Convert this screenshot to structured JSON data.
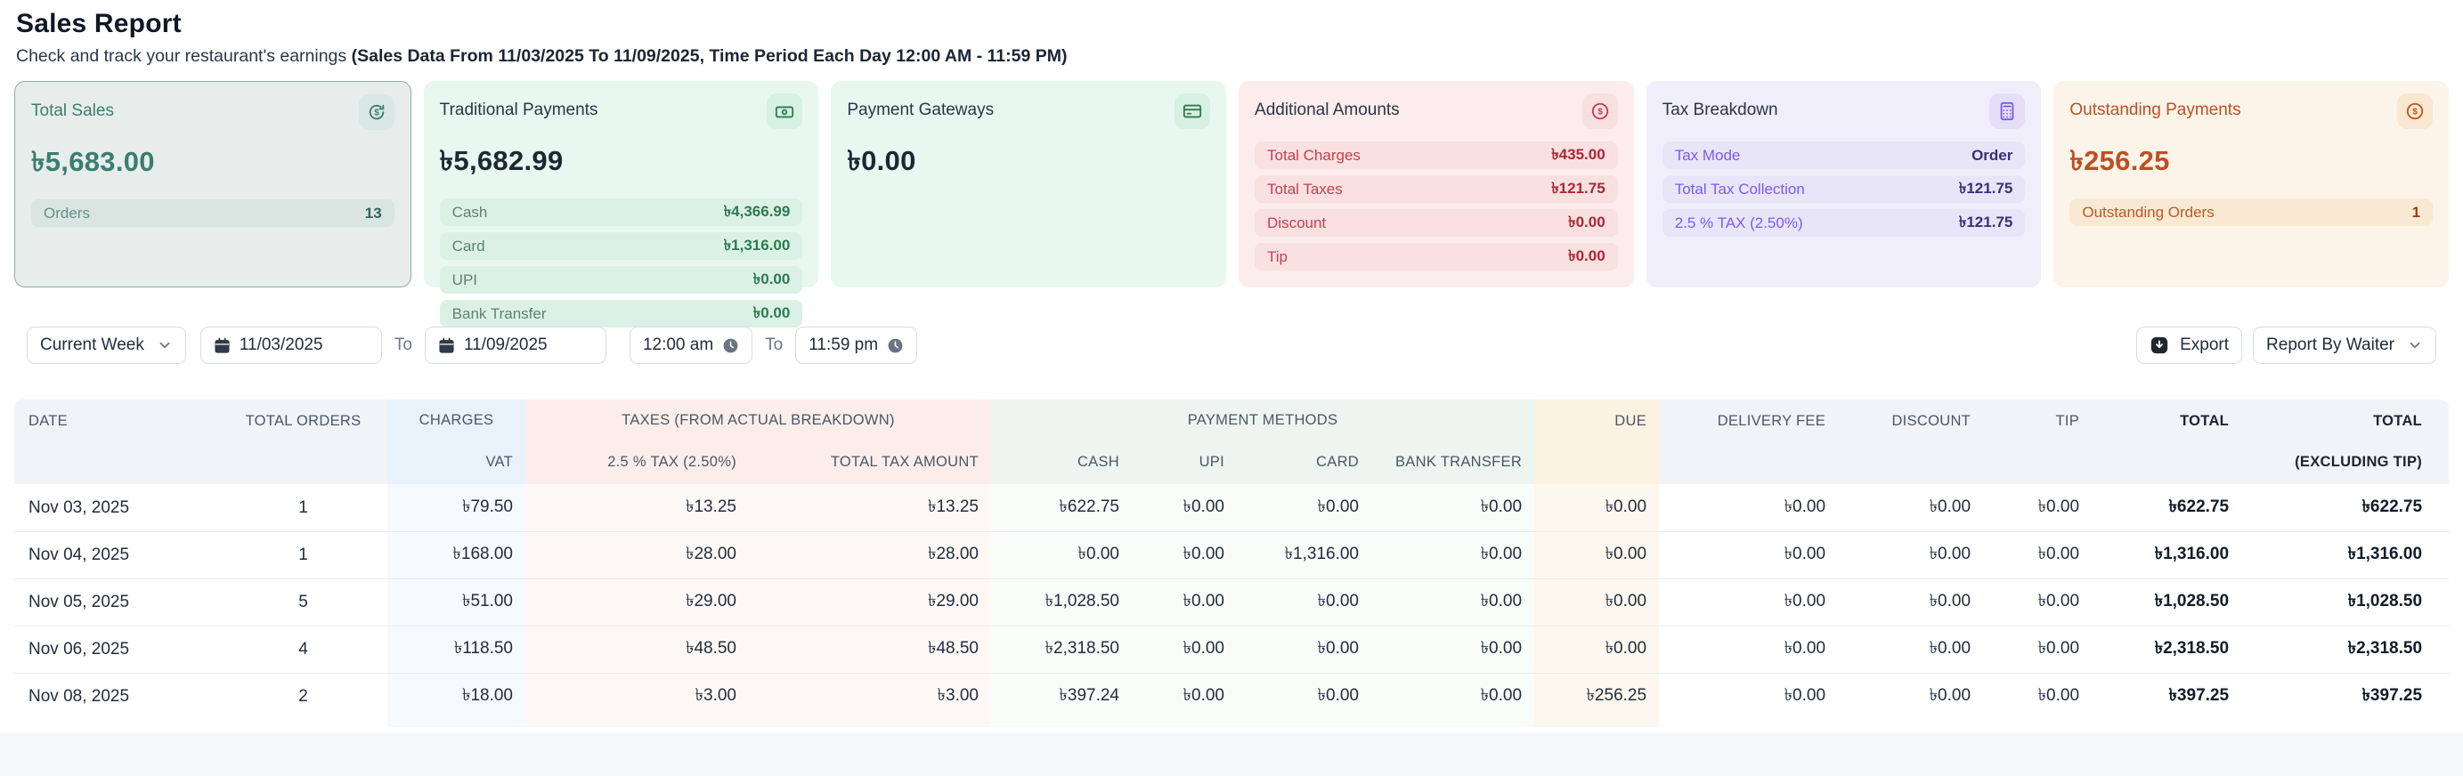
{
  "header": {
    "title": "Sales Report",
    "subtitle": "Check and track your restaurant's earnings",
    "subtitle_bold": "(Sales Data From 11/03/2025 To 11/09/2025, Time Period Each Day 12:00 AM - 11:59 PM)"
  },
  "cards": {
    "total_sales": {
      "title": "Total Sales",
      "value": "৳5,683.00",
      "rows": [
        {
          "label": "Orders",
          "value": "13"
        }
      ]
    },
    "traditional_payments": {
      "title": "Traditional Payments",
      "value": "৳5,682.99",
      "rows": [
        {
          "label": "Cash",
          "value": "৳4,366.99"
        },
        {
          "label": "Card",
          "value": "৳1,316.00"
        },
        {
          "label": "UPI",
          "value": "৳0.00"
        },
        {
          "label": "Bank Transfer",
          "value": "৳0.00"
        }
      ]
    },
    "payment_gateways": {
      "title": "Payment Gateways",
      "value": "৳0.00"
    },
    "additional_amounts": {
      "title": "Additional Amounts",
      "rows": [
        {
          "label": "Total Charges",
          "value": "৳435.00"
        },
        {
          "label": "Total Taxes",
          "value": "৳121.75"
        },
        {
          "label": "Discount",
          "value": "৳0.00"
        },
        {
          "label": "Tip",
          "value": "৳0.00"
        }
      ]
    },
    "tax_breakdown": {
      "title": "Tax Breakdown",
      "rows": [
        {
          "label": "Tax Mode",
          "value": "Order"
        },
        {
          "label": "Total Tax Collection",
          "value": "৳121.75"
        },
        {
          "label": "2.5 % TAX (2.50%)",
          "value": "৳121.75"
        }
      ]
    },
    "outstanding_payments": {
      "title": "Outstanding Payments",
      "value": "৳256.25",
      "rows": [
        {
          "label": "Outstanding Orders",
          "value": "1"
        }
      ]
    }
  },
  "icons": {
    "total_sales": "refresh-dollar-icon",
    "traditional_payments": "banknote-icon",
    "payment_gateways": "credit-card-icon",
    "additional_amounts": "circle-dollar-icon",
    "tax_breakdown": "calculator-icon",
    "outstanding_payments": "circle-dollar-icon",
    "filters": [
      "chevron-down-icon",
      "calendar-icon",
      "clock-icon",
      "download-icon"
    ]
  },
  "filters": {
    "range_select": "Current Week",
    "date_from": "11/03/2025",
    "to_label_1": "To",
    "date_to": "11/09/2025",
    "time_from": "12:00 am",
    "to_label_2": "To",
    "time_to": "11:59 pm",
    "export_label": "Export",
    "report_by_select": "Report By Waiter"
  },
  "table": {
    "headers": {
      "date": "DATE",
      "total_orders": "TOTAL ORDERS",
      "charges_group": "CHARGES",
      "vat": "VAT",
      "taxes_group": "TAXES (FROM ACTUAL BREAKDOWN)",
      "tax_25": "2.5 % TAX (2.50%)",
      "total_tax_amount": "TOTAL TAX AMOUNT",
      "payment_methods_group": "PAYMENT METHODS",
      "cash": "CASH",
      "upi": "UPI",
      "card": "CARD",
      "bank_transfer": "BANK TRANSFER",
      "due": "DUE",
      "delivery_fee": "DELIVERY FEE",
      "discount": "DISCOUNT",
      "tip": "TIP",
      "total": "TOTAL",
      "total_excl_line1": "TOTAL",
      "total_excl_line2": "(EXCLUDING TIP)"
    },
    "rows": [
      {
        "date": "Nov 03, 2025",
        "total_orders": "1",
        "vat": "৳79.50",
        "tax_25": "৳13.25",
        "total_tax_amount": "৳13.25",
        "cash": "৳622.75",
        "upi": "৳0.00",
        "card": "৳0.00",
        "bank_transfer": "৳0.00",
        "due": "৳0.00",
        "delivery_fee": "৳0.00",
        "discount": "৳0.00",
        "tip": "৳0.00",
        "total": "৳622.75",
        "total_excluding_tip": "৳622.75"
      },
      {
        "date": "Nov 04, 2025",
        "total_orders": "1",
        "vat": "৳168.00",
        "tax_25": "৳28.00",
        "total_tax_amount": "৳28.00",
        "cash": "৳0.00",
        "upi": "৳0.00",
        "card": "৳1,316.00",
        "bank_transfer": "৳0.00",
        "due": "৳0.00",
        "delivery_fee": "৳0.00",
        "discount": "৳0.00",
        "tip": "৳0.00",
        "total": "৳1,316.00",
        "total_excluding_tip": "৳1,316.00"
      },
      {
        "date": "Nov 05, 2025",
        "total_orders": "5",
        "vat": "৳51.00",
        "tax_25": "৳29.00",
        "total_tax_amount": "৳29.00",
        "cash": "৳1,028.50",
        "upi": "৳0.00",
        "card": "৳0.00",
        "bank_transfer": "৳0.00",
        "due": "৳0.00",
        "delivery_fee": "৳0.00",
        "discount": "৳0.00",
        "tip": "৳0.00",
        "total": "৳1,028.50",
        "total_excluding_tip": "৳1,028.50"
      },
      {
        "date": "Nov 06, 2025",
        "total_orders": "4",
        "vat": "৳118.50",
        "tax_25": "৳48.50",
        "total_tax_amount": "৳48.50",
        "cash": "৳2,318.50",
        "upi": "৳0.00",
        "card": "৳0.00",
        "bank_transfer": "৳0.00",
        "due": "৳0.00",
        "delivery_fee": "৳0.00",
        "discount": "৳0.00",
        "tip": "৳0.00",
        "total": "৳2,318.50",
        "total_excluding_tip": "৳2,318.50"
      },
      {
        "date": "Nov 08, 2025",
        "total_orders": "2",
        "vat": "৳18.00",
        "tax_25": "৳3.00",
        "total_tax_amount": "৳3.00",
        "cash": "৳397.24",
        "upi": "৳0.00",
        "card": "৳0.00",
        "bank_transfer": "৳0.00",
        "due": "৳256.25",
        "delivery_fee": "৳0.00",
        "discount": "৳0.00",
        "tip": "৳0.00",
        "total": "৳397.25",
        "total_excluding_tip": "৳397.25"
      }
    ]
  },
  "colors": {
    "teal_accent": "#3b7d71",
    "green_accent": "#2c7b51",
    "red_accent": "#c2414f",
    "purple_accent": "#7a5af2",
    "orange_accent": "#bd4f23",
    "header_bg": "#f1f3f6",
    "charges_col_bg": "#e9f1fb",
    "taxes_col_bg": "#fbeeea",
    "payments_col_bg": "#eef4ef",
    "due_col_bg": "#fbf2e2"
  }
}
